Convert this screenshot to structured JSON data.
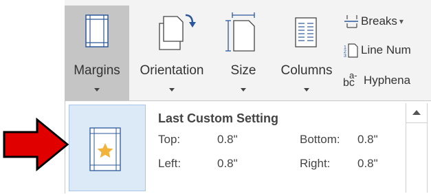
{
  "ribbon": {
    "buttons": [
      {
        "label": "Margins",
        "icon": "margins-icon"
      },
      {
        "label": "Orientation",
        "icon": "orientation-icon"
      },
      {
        "label": "Size",
        "icon": "size-icon"
      },
      {
        "label": "Columns",
        "icon": "columns-icon"
      }
    ],
    "small_items": [
      {
        "label": "Breaks",
        "icon": "breaks-icon",
        "caret": "▾"
      },
      {
        "label": "Line Num",
        "icon": "line-numbers-icon"
      },
      {
        "label": "Hyphena",
        "icon": "hyphenation-icon",
        "icon_text": "bc",
        "icon_sup": "a-"
      }
    ]
  },
  "dropdown": {
    "item": {
      "title": "Last Custom Setting",
      "top_label": "Top:",
      "top_value": "0.8\"",
      "bottom_label": "Bottom:",
      "bottom_value": "0.8\"",
      "left_label": "Left:",
      "left_value": "0.8\"",
      "right_label": "Right:",
      "right_value": "0.8\""
    }
  },
  "colors": {
    "arrow_fill": "#e00000",
    "accent": "#2b579a",
    "star": "#f2b33d"
  }
}
